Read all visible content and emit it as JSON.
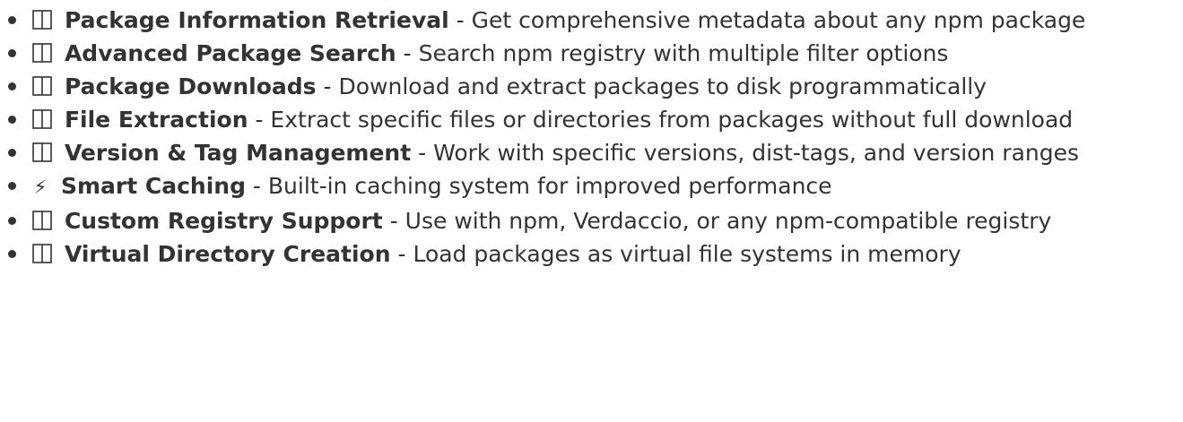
{
  "features": [
    {
      "icon": "missing-glyph-icon",
      "title": "Package Information Retrieval",
      "separator": " - ",
      "description": "Get comprehensive metadata about any npm package"
    },
    {
      "icon": "missing-glyph-icon",
      "title": "Advanced Package Search",
      "separator": " - ",
      "description": "Search npm registry with multiple filter options"
    },
    {
      "icon": "missing-glyph-icon",
      "title": "Package Downloads",
      "separator": " - ",
      "description": "Download and extract packages to disk programmatically"
    },
    {
      "icon": "missing-glyph-icon",
      "title": "File Extraction",
      "separator": " - ",
      "description": "Extract specific files or directories from packages without full download"
    },
    {
      "icon": "missing-glyph-icon",
      "title": "Version & Tag Management",
      "separator": " - ",
      "description": "Work with specific versions, dist-tags, and version ranges"
    },
    {
      "icon": "lightning-icon",
      "glyph": "⚡",
      "title": "Smart Caching",
      "separator": " - ",
      "description": "Built-in caching system for improved performance"
    },
    {
      "icon": "missing-glyph-icon",
      "title": "Custom Registry Support",
      "separator": " - ",
      "description": "Use with npm, Verdaccio, or any npm-compatible registry"
    },
    {
      "icon": "missing-glyph-icon",
      "title": "Virtual Directory Creation",
      "separator": " - ",
      "description": "Load packages as virtual file systems in memory"
    }
  ]
}
